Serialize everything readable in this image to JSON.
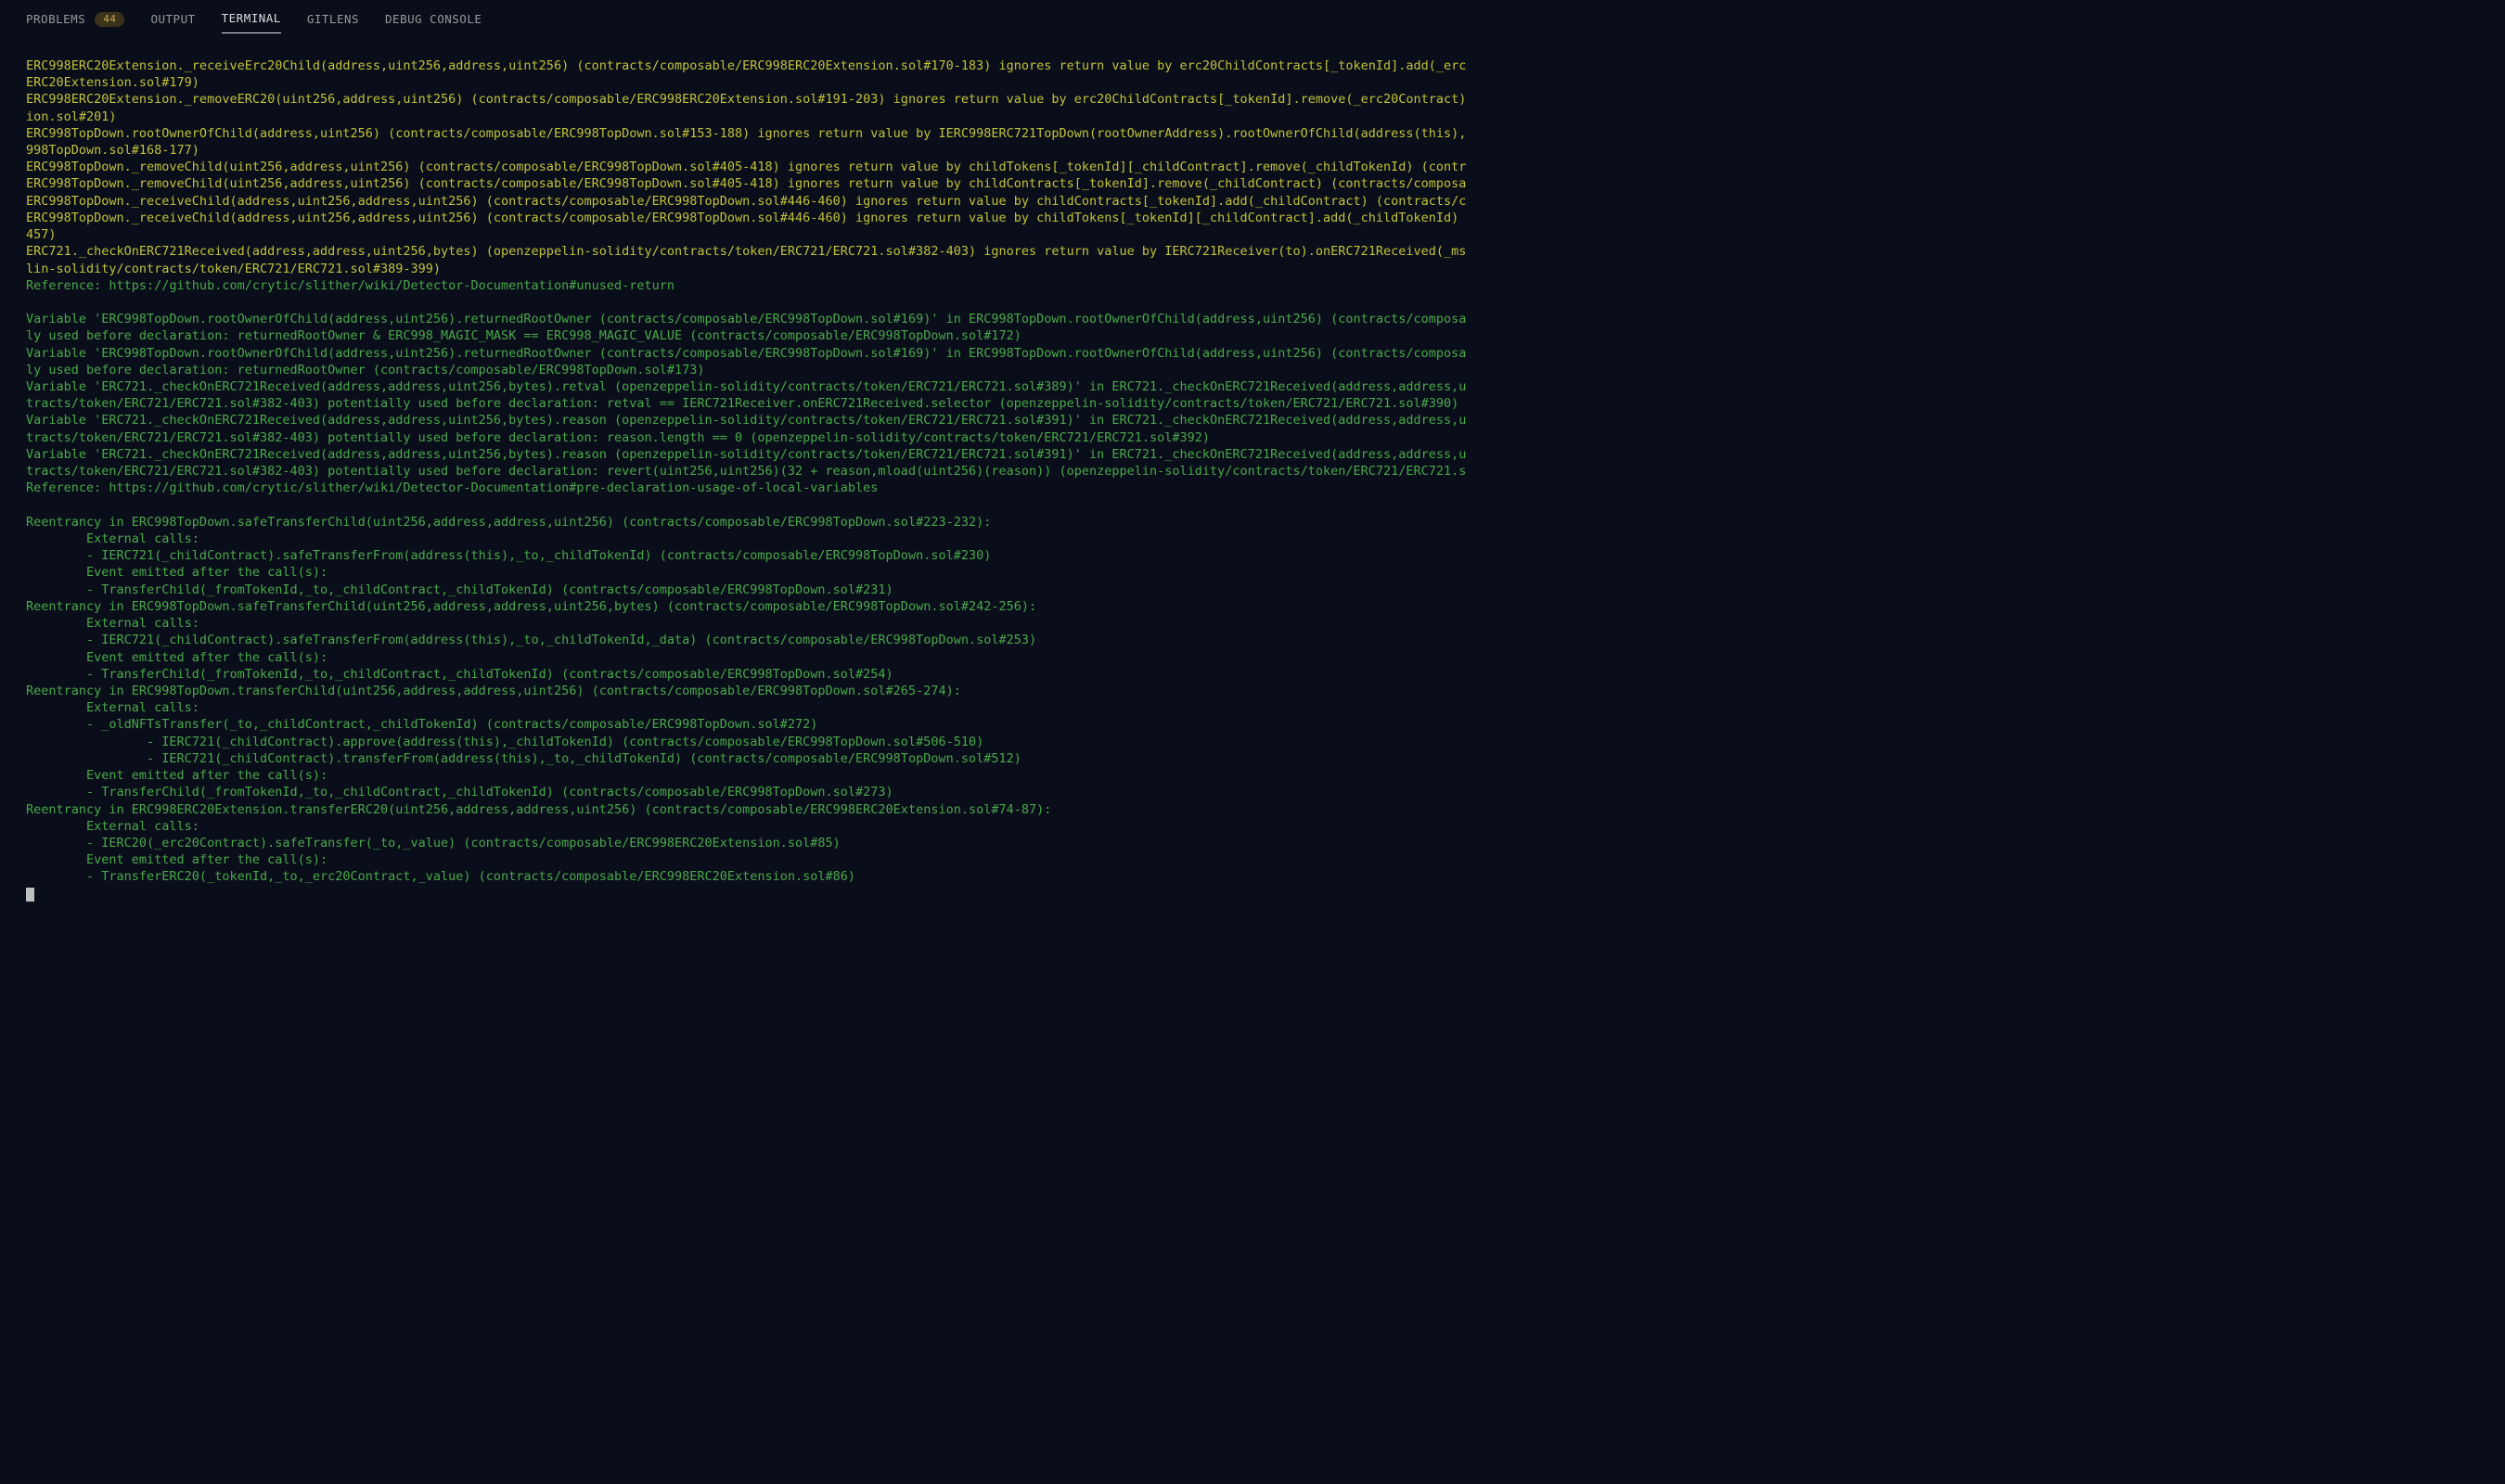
{
  "tabs": {
    "problems": "PROBLEMS",
    "problems_badge": "44",
    "output": "OUTPUT",
    "terminal": "TERMINAL",
    "gitlens": "GITLENS",
    "debug": "DEBUG CONSOLE"
  },
  "lines": [
    {
      "c": "yl",
      "t": "ERC998ERC20Extension._receiveErc20Child(address,uint256,address,uint256) (contracts/composable/ERC998ERC20Extension.sol#170-183) ignores return value by erc20ChildContracts[_tokenId].add(_erc"
    },
    {
      "c": "yl",
      "t": "ERC20Extension.sol#179)"
    },
    {
      "c": "yl",
      "t": "ERC998ERC20Extension._removeERC20(uint256,address,uint256) (contracts/composable/ERC998ERC20Extension.sol#191-203) ignores return value by erc20ChildContracts[_tokenId].remove(_erc20Contract)"
    },
    {
      "c": "yl",
      "t": "ion.sol#201)"
    },
    {
      "c": "yl",
      "t": "ERC998TopDown.rootOwnerOfChild(address,uint256) (contracts/composable/ERC998TopDown.sol#153-188) ignores return value by IERC998ERC721TopDown(rootOwnerAddress).rootOwnerOfChild(address(this),"
    },
    {
      "c": "yl",
      "t": "998TopDown.sol#168-177)"
    },
    {
      "c": "yl",
      "t": "ERC998TopDown._removeChild(uint256,address,uint256) (contracts/composable/ERC998TopDown.sol#405-418) ignores return value by childTokens[_tokenId][_childContract].remove(_childTokenId) (contr"
    },
    {
      "c": "yl",
      "t": "ERC998TopDown._removeChild(uint256,address,uint256) (contracts/composable/ERC998TopDown.sol#405-418) ignores return value by childContracts[_tokenId].remove(_childContract) (contracts/composa"
    },
    {
      "c": "yl",
      "t": "ERC998TopDown._receiveChild(address,uint256,address,uint256) (contracts/composable/ERC998TopDown.sol#446-460) ignores return value by childContracts[_tokenId].add(_childContract) (contracts/c"
    },
    {
      "c": "yl",
      "t": "ERC998TopDown._receiveChild(address,uint256,address,uint256) (contracts/composable/ERC998TopDown.sol#446-460) ignores return value by childTokens[_tokenId][_childContract].add(_childTokenId)"
    },
    {
      "c": "yl",
      "t": "457)"
    },
    {
      "c": "yl",
      "t": "ERC721._checkOnERC721Received(address,address,uint256,bytes) (openzeppelin-solidity/contracts/token/ERC721/ERC721.sol#382-403) ignores return value by IERC721Receiver(to).onERC721Received(_ms"
    },
    {
      "c": "yl",
      "t": "lin-solidity/contracts/token/ERC721/ERC721.sol#389-399)"
    },
    {
      "c": "gr",
      "t": "Reference: https://github.com/crytic/slither/wiki/Detector-Documentation#unused-return"
    },
    {
      "c": "",
      "t": ""
    },
    {
      "c": "gr",
      "t": "Variable 'ERC998TopDown.rootOwnerOfChild(address,uint256).returnedRootOwner (contracts/composable/ERC998TopDown.sol#169)' in ERC998TopDown.rootOwnerOfChild(address,uint256) (contracts/composa"
    },
    {
      "c": "gr",
      "t": "ly used before declaration: returnedRootOwner & ERC998_MAGIC_MASK == ERC998_MAGIC_VALUE (contracts/composable/ERC998TopDown.sol#172)"
    },
    {
      "c": "gr",
      "t": "Variable 'ERC998TopDown.rootOwnerOfChild(address,uint256).returnedRootOwner (contracts/composable/ERC998TopDown.sol#169)' in ERC998TopDown.rootOwnerOfChild(address,uint256) (contracts/composa"
    },
    {
      "c": "gr",
      "t": "ly used before declaration: returnedRootOwner (contracts/composable/ERC998TopDown.sol#173)"
    },
    {
      "c": "gr",
      "t": "Variable 'ERC721._checkOnERC721Received(address,address,uint256,bytes).retval (openzeppelin-solidity/contracts/token/ERC721/ERC721.sol#389)' in ERC721._checkOnERC721Received(address,address,u"
    },
    {
      "c": "gr",
      "t": "tracts/token/ERC721/ERC721.sol#382-403) potentially used before declaration: retval == IERC721Receiver.onERC721Received.selector (openzeppelin-solidity/contracts/token/ERC721/ERC721.sol#390)"
    },
    {
      "c": "gr",
      "t": "Variable 'ERC721._checkOnERC721Received(address,address,uint256,bytes).reason (openzeppelin-solidity/contracts/token/ERC721/ERC721.sol#391)' in ERC721._checkOnERC721Received(address,address,u"
    },
    {
      "c": "gr",
      "t": "tracts/token/ERC721/ERC721.sol#382-403) potentially used before declaration: reason.length == 0 (openzeppelin-solidity/contracts/token/ERC721/ERC721.sol#392)"
    },
    {
      "c": "gr",
      "t": "Variable 'ERC721._checkOnERC721Received(address,address,uint256,bytes).reason (openzeppelin-solidity/contracts/token/ERC721/ERC721.sol#391)' in ERC721._checkOnERC721Received(address,address,u"
    },
    {
      "c": "gr",
      "t": "tracts/token/ERC721/ERC721.sol#382-403) potentially used before declaration: revert(uint256,uint256)(32 + reason,mload(uint256)(reason)) (openzeppelin-solidity/contracts/token/ERC721/ERC721.s"
    },
    {
      "c": "gr",
      "t": "Reference: https://github.com/crytic/slither/wiki/Detector-Documentation#pre-declaration-usage-of-local-variables"
    },
    {
      "c": "",
      "t": ""
    },
    {
      "c": "gr",
      "t": "Reentrancy in ERC998TopDown.safeTransferChild(uint256,address,address,uint256) (contracts/composable/ERC998TopDown.sol#223-232):"
    },
    {
      "c": "gr",
      "t": "        External calls:"
    },
    {
      "c": "gr",
      "t": "        - IERC721(_childContract).safeTransferFrom(address(this),_to,_childTokenId) (contracts/composable/ERC998TopDown.sol#230)"
    },
    {
      "c": "gr",
      "t": "        Event emitted after the call(s):"
    },
    {
      "c": "gr",
      "t": "        - TransferChild(_fromTokenId,_to,_childContract,_childTokenId) (contracts/composable/ERC998TopDown.sol#231)"
    },
    {
      "c": "gr",
      "t": "Reentrancy in ERC998TopDown.safeTransferChild(uint256,address,address,uint256,bytes) (contracts/composable/ERC998TopDown.sol#242-256):"
    },
    {
      "c": "gr",
      "t": "        External calls:"
    },
    {
      "c": "gr",
      "t": "        - IERC721(_childContract).safeTransferFrom(address(this),_to,_childTokenId,_data) (contracts/composable/ERC998TopDown.sol#253)"
    },
    {
      "c": "gr",
      "t": "        Event emitted after the call(s):"
    },
    {
      "c": "gr",
      "t": "        - TransferChild(_fromTokenId,_to,_childContract,_childTokenId) (contracts/composable/ERC998TopDown.sol#254)"
    },
    {
      "c": "gr",
      "t": "Reentrancy in ERC998TopDown.transferChild(uint256,address,address,uint256) (contracts/composable/ERC998TopDown.sol#265-274):"
    },
    {
      "c": "gr",
      "t": "        External calls:"
    },
    {
      "c": "gr",
      "t": "        - _oldNFTsTransfer(_to,_childContract,_childTokenId) (contracts/composable/ERC998TopDown.sol#272)"
    },
    {
      "c": "gr",
      "t": "                - IERC721(_childContract).approve(address(this),_childTokenId) (contracts/composable/ERC998TopDown.sol#506-510)"
    },
    {
      "c": "gr",
      "t": "                - IERC721(_childContract).transferFrom(address(this),_to,_childTokenId) (contracts/composable/ERC998TopDown.sol#512)"
    },
    {
      "c": "gr",
      "t": "        Event emitted after the call(s):"
    },
    {
      "c": "gr",
      "t": "        - TransferChild(_fromTokenId,_to,_childContract,_childTokenId) (contracts/composable/ERC998TopDown.sol#273)"
    },
    {
      "c": "gr",
      "t": "Reentrancy in ERC998ERC20Extension.transferERC20(uint256,address,address,uint256) (contracts/composable/ERC998ERC20Extension.sol#74-87):"
    },
    {
      "c": "gr",
      "t": "        External calls:"
    },
    {
      "c": "gr",
      "t": "        - IERC20(_erc20Contract).safeTransfer(_to,_value) (contracts/composable/ERC998ERC20Extension.sol#85)"
    },
    {
      "c": "gr",
      "t": "        Event emitted after the call(s):"
    },
    {
      "c": "gr",
      "t": "        - TransferERC20(_tokenId,_to,_erc20Contract,_value) (contracts/composable/ERC998ERC20Extension.sol#86)"
    }
  ]
}
